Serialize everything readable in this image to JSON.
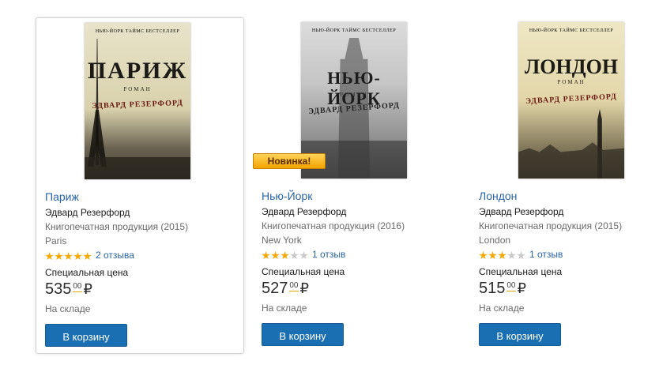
{
  "products": [
    {
      "cover": {
        "top_line": "НЬЮ-ЙОРК ТАЙМС БЕСТСЕЛЛЕР",
        "big_title": "ПАРИЖ",
        "genre": "РОМАН",
        "author": "ЭДВАРД РЕЗЕРФОРД"
      },
      "title": "Париж",
      "author": "Эдвард Резерфорд",
      "publisher": "Книгопечатная продукция (2015)",
      "original_title": "Paris",
      "rating": 5,
      "reviews": "2 отзыва",
      "special_label": "Специальная цена",
      "price_rub": "535",
      "price_kop": "00",
      "currency": "₽",
      "stock": "На складе",
      "button": "В корзину",
      "is_new": false
    },
    {
      "cover": {
        "top_line": "НЬЮ-ЙОРК ТАЙМС БЕСТСЕЛЛЕР",
        "big_title": "НЬЮ-ЙОРК",
        "genre": "РОМАН",
        "author": "ЭДВАРД РЕЗЕРФОРД"
      },
      "title": "Нью-Йорк",
      "author": "Эдвард Резерфорд",
      "publisher": "Книгопечатная продукция (2016)",
      "original_title": "New York",
      "rating": 3,
      "reviews": "1 отзыв",
      "special_label": "Специальная цена",
      "price_rub": "527",
      "price_kop": "00",
      "currency": "₽",
      "stock": "На складе",
      "button": "В корзину",
      "is_new": true,
      "new_badge": "Новинка!"
    },
    {
      "cover": {
        "top_line": "НЬЮ-ЙОРК ТАЙМС БЕСТСЕЛЛЕР",
        "big_title": "ЛОНДОН",
        "genre": "РОМАН",
        "author": "ЭДВАРД РЕЗЕРФОРД"
      },
      "title": "Лондон",
      "author": "Эдвард Резерфорд",
      "publisher": "Книгопечатная продукция (2015)",
      "original_title": "London",
      "rating": 3,
      "reviews": "1 отзыв",
      "special_label": "Специальная цена",
      "price_rub": "515",
      "price_kop": "00",
      "currency": "₽",
      "stock": "На складе",
      "button": "В корзину",
      "is_new": false
    }
  ],
  "colors": {
    "link": "#2a64a8",
    "button": "#1a6fb3",
    "star_on": "#f5a800",
    "star_off": "#c8c8c8",
    "badge": "#f3a400"
  }
}
